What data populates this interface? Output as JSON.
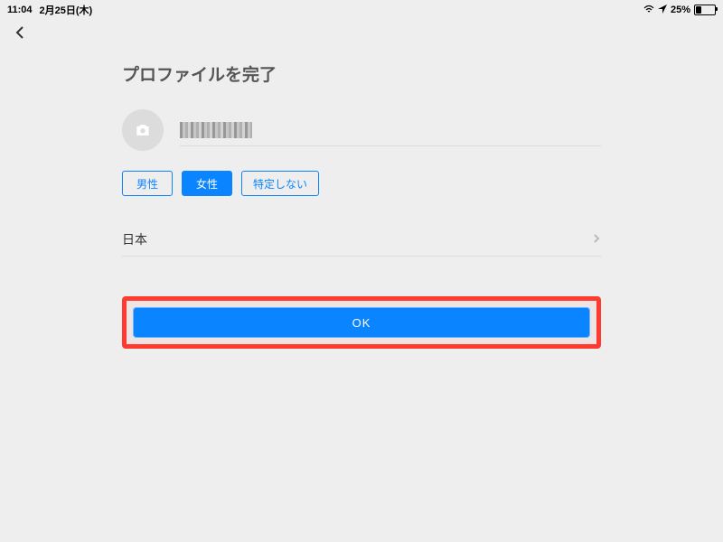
{
  "status": {
    "time": "11:04",
    "date": "2月25日(木)",
    "battery_pct": "25%"
  },
  "page": {
    "title": "プロファイルを完了"
  },
  "profile": {
    "name_value": ""
  },
  "gender": {
    "options": [
      {
        "label": "男性",
        "selected": false
      },
      {
        "label": "女性",
        "selected": true
      },
      {
        "label": "特定しない",
        "selected": false
      }
    ]
  },
  "country": {
    "value": "日本"
  },
  "submit": {
    "label": "OK"
  }
}
